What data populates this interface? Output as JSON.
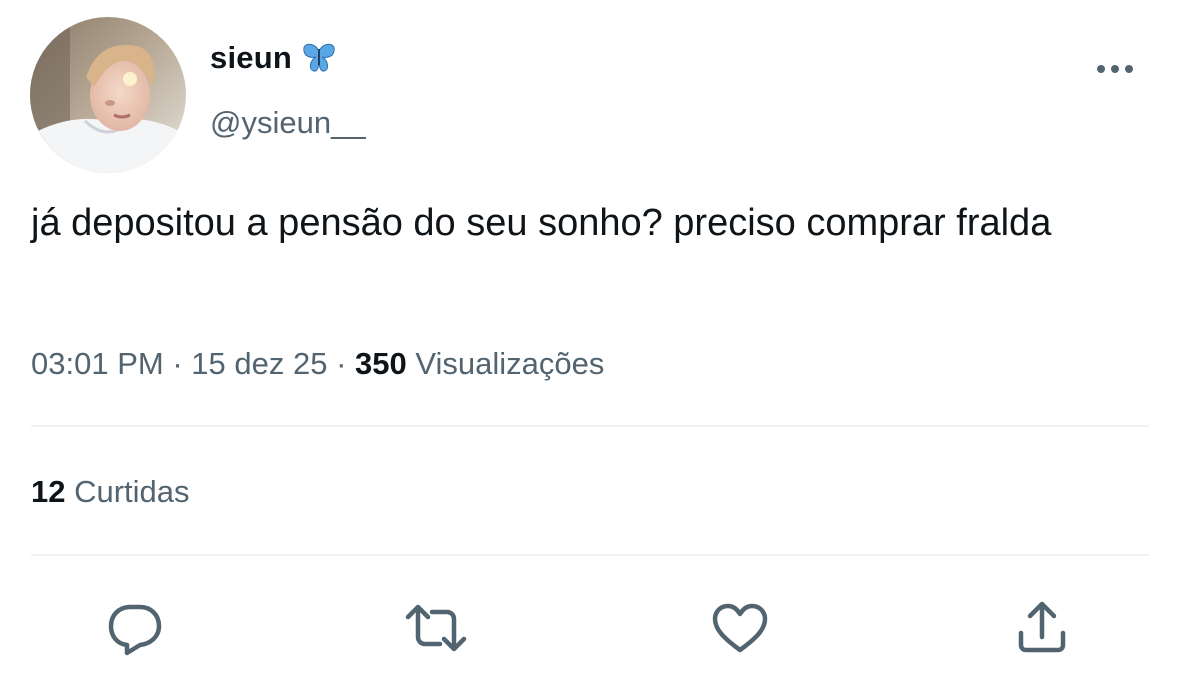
{
  "author": {
    "display_name": "sieun",
    "handle": "@ysieun__",
    "badge_icon": "butterfly-icon",
    "badge_color": "#4a9bd9",
    "avatar_icon": "profile-photo"
  },
  "menu": {
    "icon": "more-options-icon"
  },
  "tweet": {
    "text": "já depositou a pensão do seu sonho? preciso comprar fralda"
  },
  "meta": {
    "time": "03:01 PM",
    "separator": "·",
    "date": "15 dez 25",
    "views_count": "350",
    "views_label": "Visualizações"
  },
  "stats": {
    "likes_count": "12",
    "likes_label": "Curtidas"
  },
  "actions": [
    {
      "icon": "reply-icon"
    },
    {
      "icon": "retweet-icon"
    },
    {
      "icon": "like-icon"
    },
    {
      "icon": "share-icon"
    }
  ],
  "colors": {
    "text_primary": "#0f1419",
    "text_secondary": "#536471",
    "icon_gray": "#536471",
    "divider": "#eff3f4"
  }
}
